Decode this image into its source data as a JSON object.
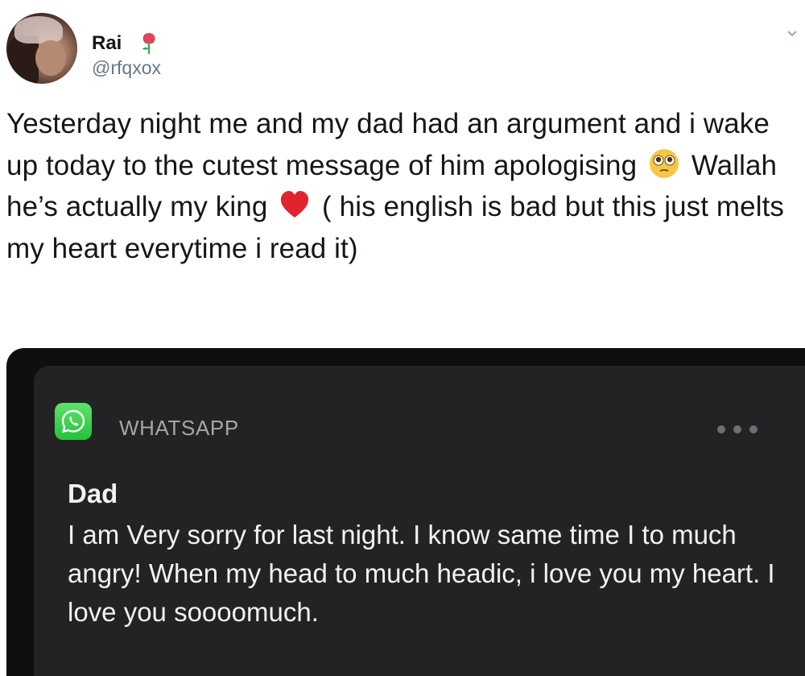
{
  "user": {
    "display_name": "Rai",
    "handle": "@rfqxox"
  },
  "tweet": {
    "text_part1": "Yesterday night me and my dad had an argument and i wake up today to the cutest message of him apologising",
    "text_part2": "Wallah he’s actually my king",
    "text_part3": "( his english is bad but this just melts my heart everytime i read it)"
  },
  "icons": {
    "name_emoji": "rose-icon",
    "emoji_1": "pleading-face-icon",
    "emoji_2": "red-heart-icon",
    "menu": "chevron-down-icon",
    "app": "whatsapp-icon",
    "more": "more-dots-icon"
  },
  "notification": {
    "app_name": "WHATSAPP",
    "sender": "Dad",
    "message": "I am Very sorry for last night. I know same time I to much angry! When my head to much headic, i love you my heart. I love you soooomuch."
  },
  "colors": {
    "text": "#14171a",
    "handle": "#657786",
    "notification_bg": "#232325",
    "whatsapp_green": "#25c13a",
    "heart_red": "#e0242f"
  }
}
